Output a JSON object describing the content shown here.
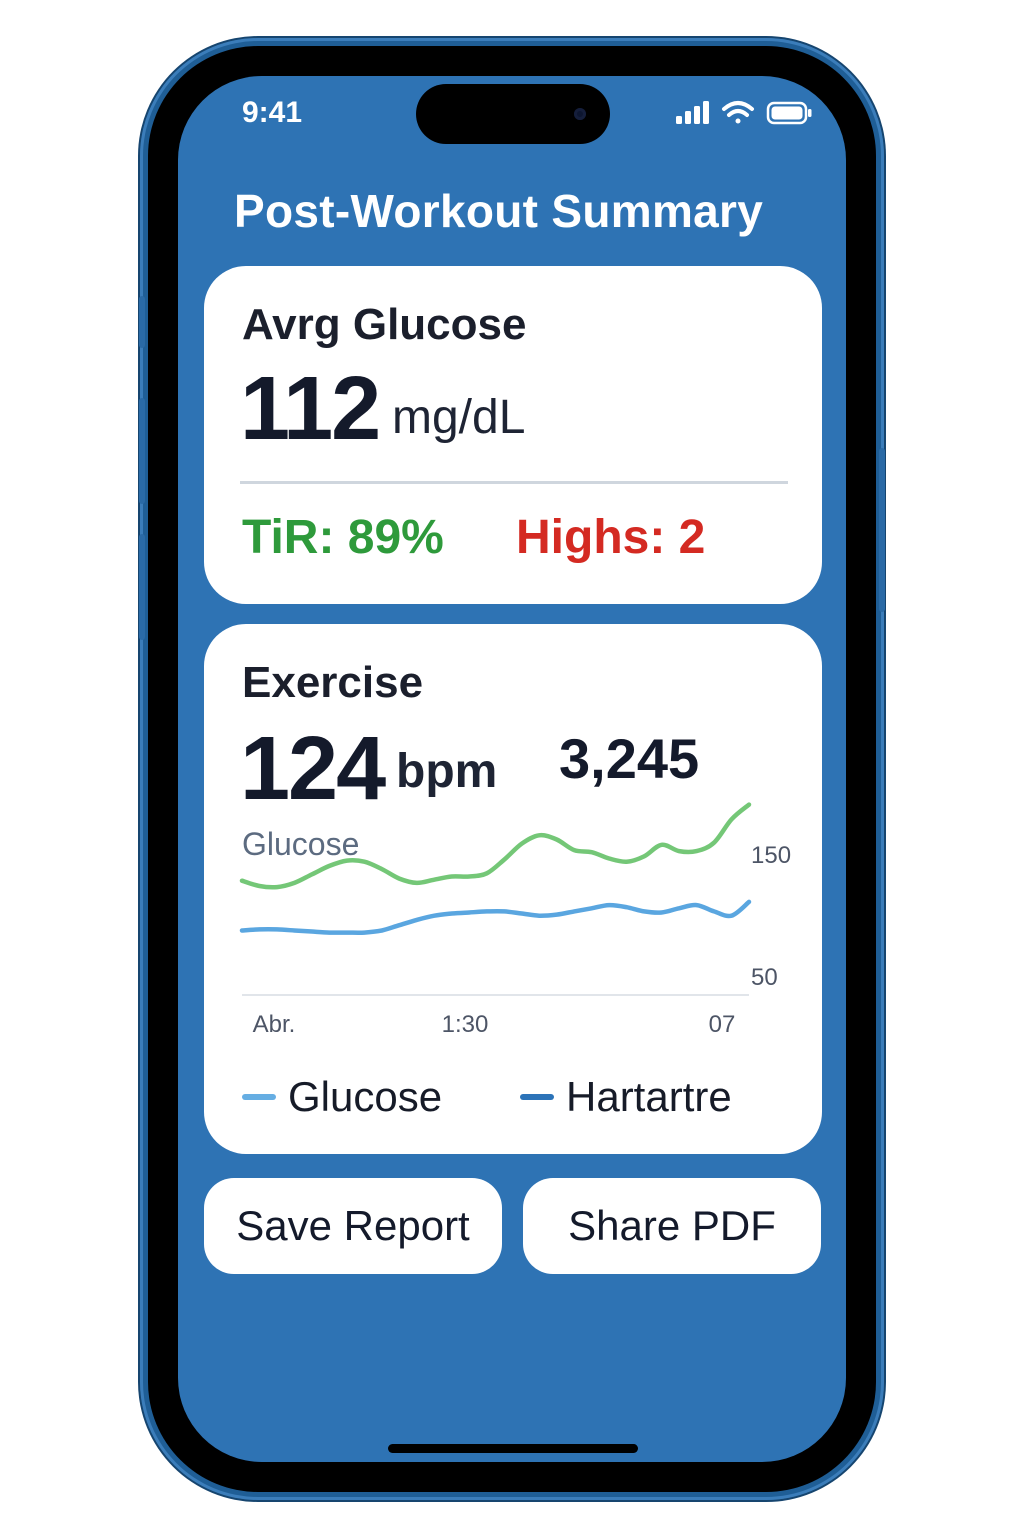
{
  "status_bar": {
    "time": "9:41",
    "icons": [
      "cellular-signal-icon",
      "wifi-icon",
      "battery-icon"
    ]
  },
  "page_title": "Post-Workout Summary",
  "glucose_card": {
    "title": "Avrg Glucose",
    "value": "112",
    "unit": "mg/dL",
    "tir": "TiR: 89%",
    "highs": "Highs: 2"
  },
  "exercise_card": {
    "title": "Exercise",
    "heart_rate_value": "124",
    "heart_rate_unit": "bpm",
    "steps_value": "3,245"
  },
  "chart_data": {
    "type": "line",
    "title": "Glucose",
    "x_ticks": [
      "Abr.",
      "1:30",
      "07"
    ],
    "y_ticks": [
      150,
      50
    ],
    "ylim": [
      0,
      190
    ],
    "grid": false,
    "legend_position": "bottom",
    "series": [
      {
        "color": "#74c777",
        "values": [
          108,
          103,
          102,
          106,
          114,
          122,
          127,
          126,
          119,
          110,
          106,
          109,
          112,
          112,
          115,
          128,
          143,
          151,
          147,
          137,
          135,
          129,
          126,
          131,
          142,
          136,
          136,
          144,
          166,
          180
        ]
      },
      {
        "color": "#5aa6e0",
        "values": [
          61,
          62,
          62,
          61,
          60,
          59,
          59,
          59,
          61,
          66,
          71,
          75,
          77,
          78,
          79,
          79,
          77,
          75,
          76,
          79,
          82,
          85,
          83,
          79,
          78,
          82,
          85,
          79,
          75,
          88
        ]
      }
    ]
  },
  "legend": [
    {
      "label": "Glucose",
      "color": "#66aee3"
    },
    {
      "label": "Hartartre",
      "color": "#2c73b8"
    }
  ],
  "buttons": {
    "save_label": "Save Report",
    "share_label": "Share PDF"
  },
  "colors": {
    "screen_background": "#2e73b4",
    "tir_green": "#2e9a3b",
    "highs_red": "#d42a22"
  }
}
